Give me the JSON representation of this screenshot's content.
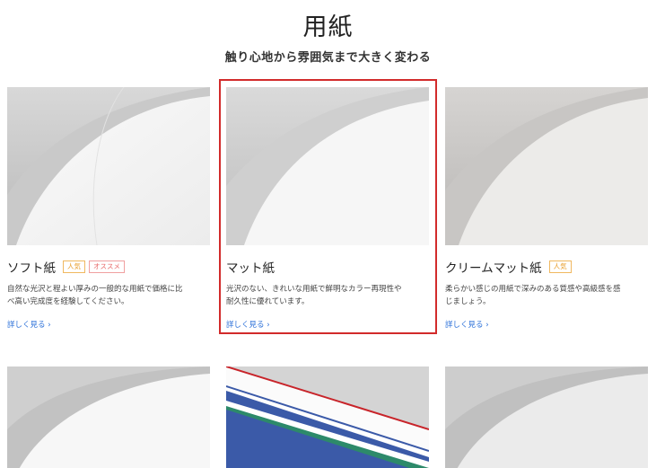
{
  "page": {
    "title": "用紙",
    "subtitle": "触り心地から雰囲気まで大きく変わる"
  },
  "cards": [
    {
      "name": "ソフト紙",
      "badges": [
        "人気",
        "オススメ"
      ],
      "description": "自然な光沢と程よい厚みの一般的な用紙で価格に比べ高い完成度を経験してください。",
      "more": "詳しく見る ›"
    },
    {
      "name": "マット紙",
      "badges": [],
      "description": "光沢のない、きれいな用紙で鮮明なカラー再現性や耐久性に優れています。",
      "more": "詳しく見る ›"
    },
    {
      "name": "クリームマット紙",
      "badges": [
        "人気"
      ],
      "description": "柔らかい感じの用紙で深みのある質感や高級感を感じましょう。",
      "more": "詳しく見る ›"
    }
  ],
  "colors": {
    "accent_link": "#2a6fd8",
    "highlight_border": "#d22b2b",
    "badge_popular": "#e8a030",
    "badge_recommend": "#e86a6a"
  }
}
